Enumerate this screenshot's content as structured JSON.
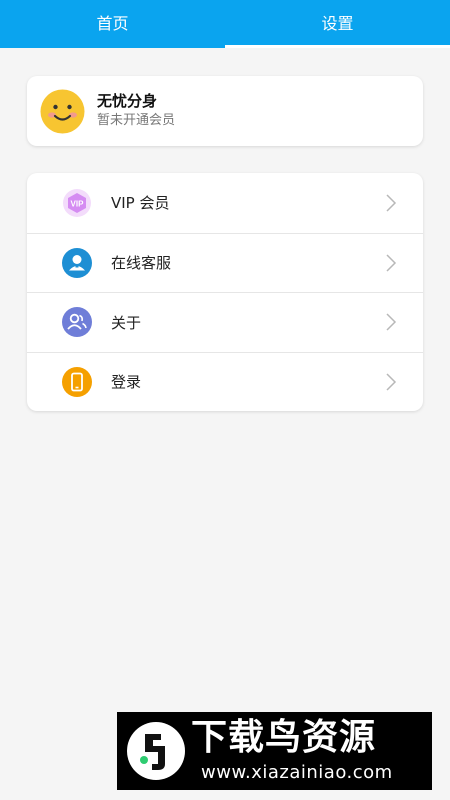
{
  "tabs": [
    {
      "label": "首页",
      "active": false
    },
    {
      "label": "设置",
      "active": true
    }
  ],
  "profile": {
    "name": "无忧分身",
    "status": "暂未开通会员",
    "avatar_icon": "smiley-face-icon"
  },
  "menu": [
    {
      "label": "VIP 会员",
      "icon": "vip-badge-icon",
      "icon_text": "VIP",
      "color": "#c86df0"
    },
    {
      "label": "在线客服",
      "icon": "customer-service-icon",
      "color": "#1e8fd4"
    },
    {
      "label": "关于",
      "icon": "users-icon",
      "color": "#6f7ed8"
    },
    {
      "label": "登录",
      "icon": "phone-icon",
      "color": "#f5a000"
    }
  ],
  "watermark": {
    "title": "下载鸟资源",
    "url": "www.xiazainiao.com"
  },
  "colors": {
    "accent": "#0aa4ef",
    "background": "#f5f5f5"
  }
}
